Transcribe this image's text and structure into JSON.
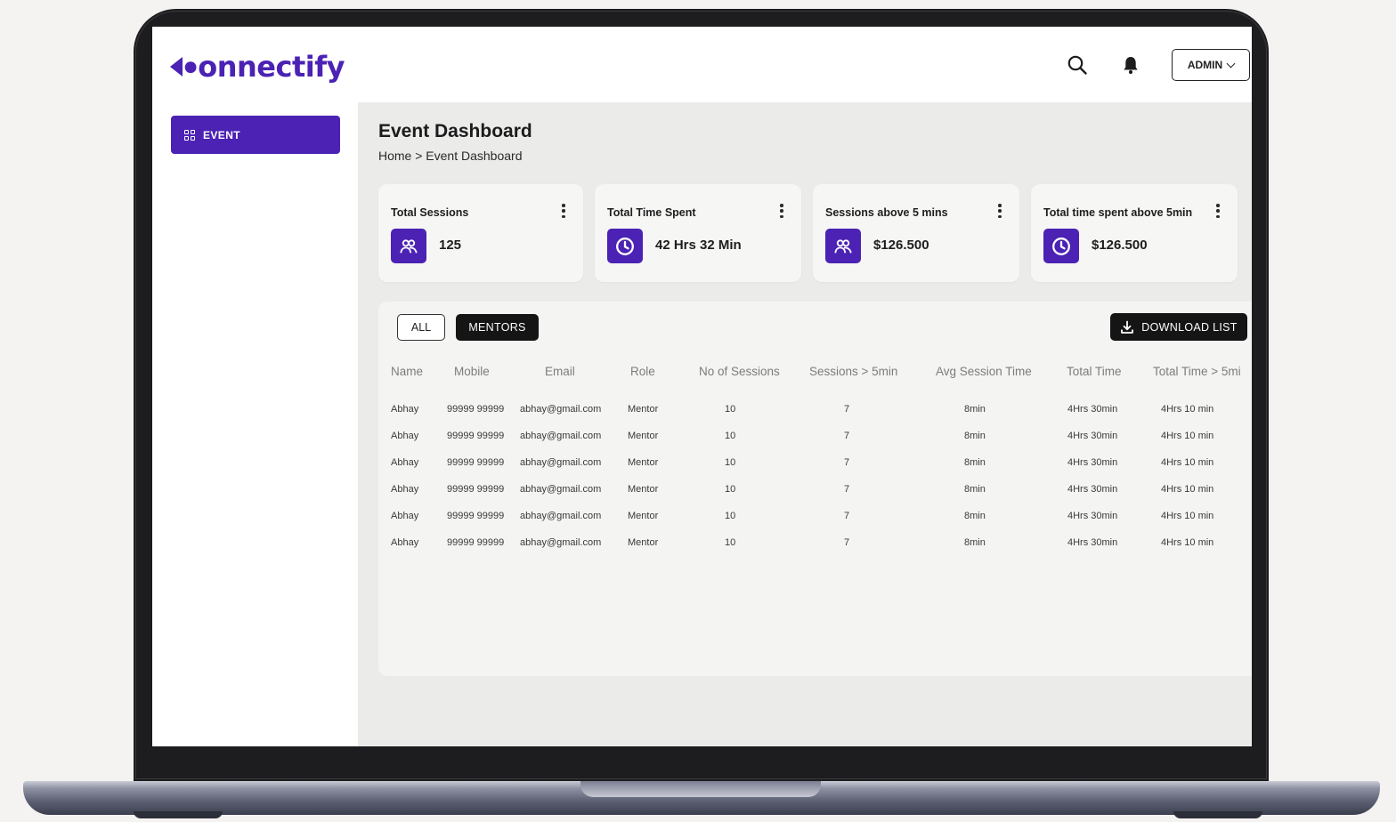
{
  "brand": {
    "logo_text": "onnectify",
    "accent": "#4b22b4"
  },
  "sidebar": {
    "items": [
      {
        "label": "EVENT",
        "icon": "grid-icon",
        "active": true
      }
    ]
  },
  "topbar": {
    "search_icon": "search-icon",
    "bell_icon": "bell-icon",
    "admin_label": "ADMIN"
  },
  "page": {
    "title": "Event Dashboard",
    "breadcrumb": "Home > Event Dashboard"
  },
  "cards": [
    {
      "title": "Total Sessions",
      "value": "125",
      "icon": "users-icon"
    },
    {
      "title": "Total Time Spent",
      "value": "42 Hrs 32 Min",
      "icon": "clock-icon"
    },
    {
      "title": "Sessions above 5 mins",
      "value": "$126.500",
      "icon": "users-icon"
    },
    {
      "title": "Total time spent above 5min",
      "value": "$126.500",
      "icon": "clock-icon"
    }
  ],
  "filters": {
    "all_label": "ALL",
    "mentors_label": "MENTORS",
    "selected": "MENTORS"
  },
  "download_label": "DOWNLOAD LIST",
  "table": {
    "headers": [
      "Name",
      "Mobile",
      "Email",
      "Role",
      "No of Sessions",
      "Sessions > 5min",
      "Avg Session Time",
      "Total Time",
      "Total Time > 5mi"
    ],
    "rows": [
      [
        "Abhay",
        "99999 99999",
        "abhay@gmail.com",
        "Mentor",
        "10",
        "7",
        "8min",
        "4Hrs 30min",
        "4Hrs 10 min"
      ],
      [
        "Abhay",
        "99999 99999",
        "abhay@gmail.com",
        "Mentor",
        "10",
        "7",
        "8min",
        "4Hrs 30min",
        "4Hrs 10 min"
      ],
      [
        "Abhay",
        "99999 99999",
        "abhay@gmail.com",
        "Mentor",
        "10",
        "7",
        "8min",
        "4Hrs 30min",
        "4Hrs 10 min"
      ],
      [
        "Abhay",
        "99999 99999",
        "abhay@gmail.com",
        "Mentor",
        "10",
        "7",
        "8min",
        "4Hrs 30min",
        "4Hrs 10 min"
      ],
      [
        "Abhay",
        "99999 99999",
        "abhay@gmail.com",
        "Mentor",
        "10",
        "7",
        "8min",
        "4Hrs 30min",
        "4Hrs 10 min"
      ],
      [
        "Abhay",
        "99999 99999",
        "abhay@gmail.com",
        "Mentor",
        "10",
        "7",
        "8min",
        "4Hrs 30min",
        "4Hrs 10 min"
      ]
    ]
  }
}
